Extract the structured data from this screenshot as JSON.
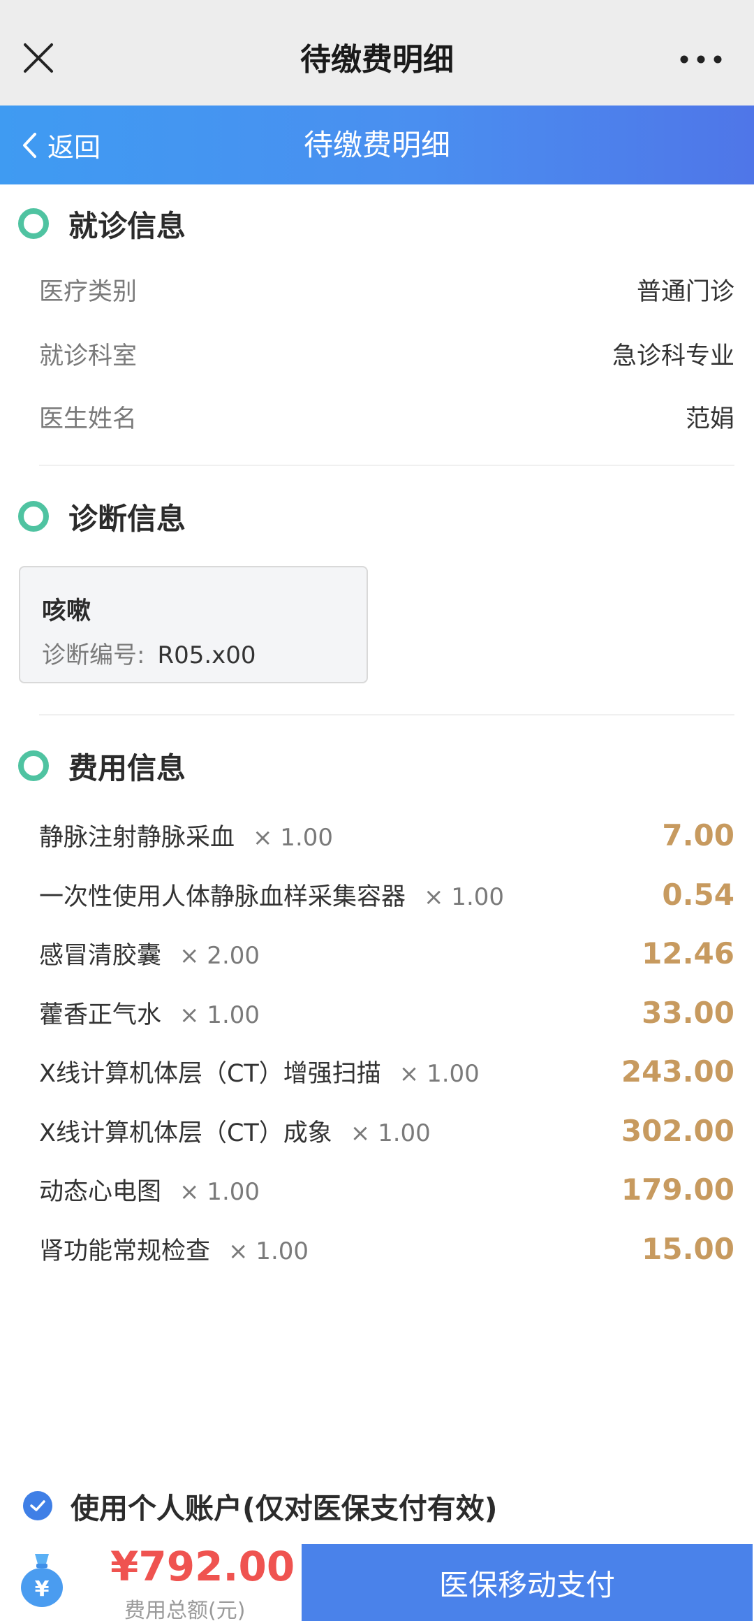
{
  "window": {
    "title": "待缴费明细"
  },
  "header": {
    "back_label": "返回",
    "title": "待缴费明细"
  },
  "visit": {
    "section_title": "就诊信息",
    "rows": [
      {
        "label": "医疗类别",
        "value": "普通门诊"
      },
      {
        "label": "就诊科室",
        "value": "急诊科专业"
      },
      {
        "label": "医生姓名",
        "value": "范娟"
      }
    ]
  },
  "diagnosis": {
    "section_title": "诊断信息",
    "name": "咳嗽",
    "code_label": "诊断编号:",
    "code": "R05.x00"
  },
  "fees": {
    "section_title": "费用信息",
    "items": [
      {
        "name": "静脉注射静脉采血",
        "qty": "× 1.00",
        "amount": "7.00"
      },
      {
        "name": "一次性使用人体静脉血样采集容器",
        "qty": "× 1.00",
        "amount": "0.54"
      },
      {
        "name": "感冒清胶囊",
        "qty": "× 2.00",
        "amount": "12.46"
      },
      {
        "name": "藿香正气水",
        "qty": "× 1.00",
        "amount": "33.00"
      },
      {
        "name": "X线计算机体层（CT）增强扫描",
        "qty": "× 1.00",
        "amount": "243.00"
      },
      {
        "name": "X线计算机体层（CT）成象",
        "qty": "× 1.00",
        "amount": "302.00"
      },
      {
        "name": "动态心电图",
        "qty": "× 1.00",
        "amount": "179.00"
      },
      {
        "name": "肾功能常规检查",
        "qty": "× 1.00",
        "amount": "15.00"
      }
    ]
  },
  "footer": {
    "account_label": "使用个人账户(仅对医保支付有效)",
    "account_checked": true,
    "total_amount": "¥792.00",
    "total_label": "费用总额(元)",
    "pay_button": "医保移动支付",
    "bag_symbol": "¥"
  },
  "colors": {
    "header_start": "#3f9bf2",
    "header_end": "#4f76e8",
    "ring": "#4fc3a1",
    "amount": "#c79a5f",
    "total": "#ef5350",
    "pay_button": "#4a82ea"
  },
  "icons": [
    "close-icon",
    "more-icon",
    "chevron-left-icon",
    "section-ring-icon",
    "check-circle-icon",
    "money-bag-icon"
  ]
}
